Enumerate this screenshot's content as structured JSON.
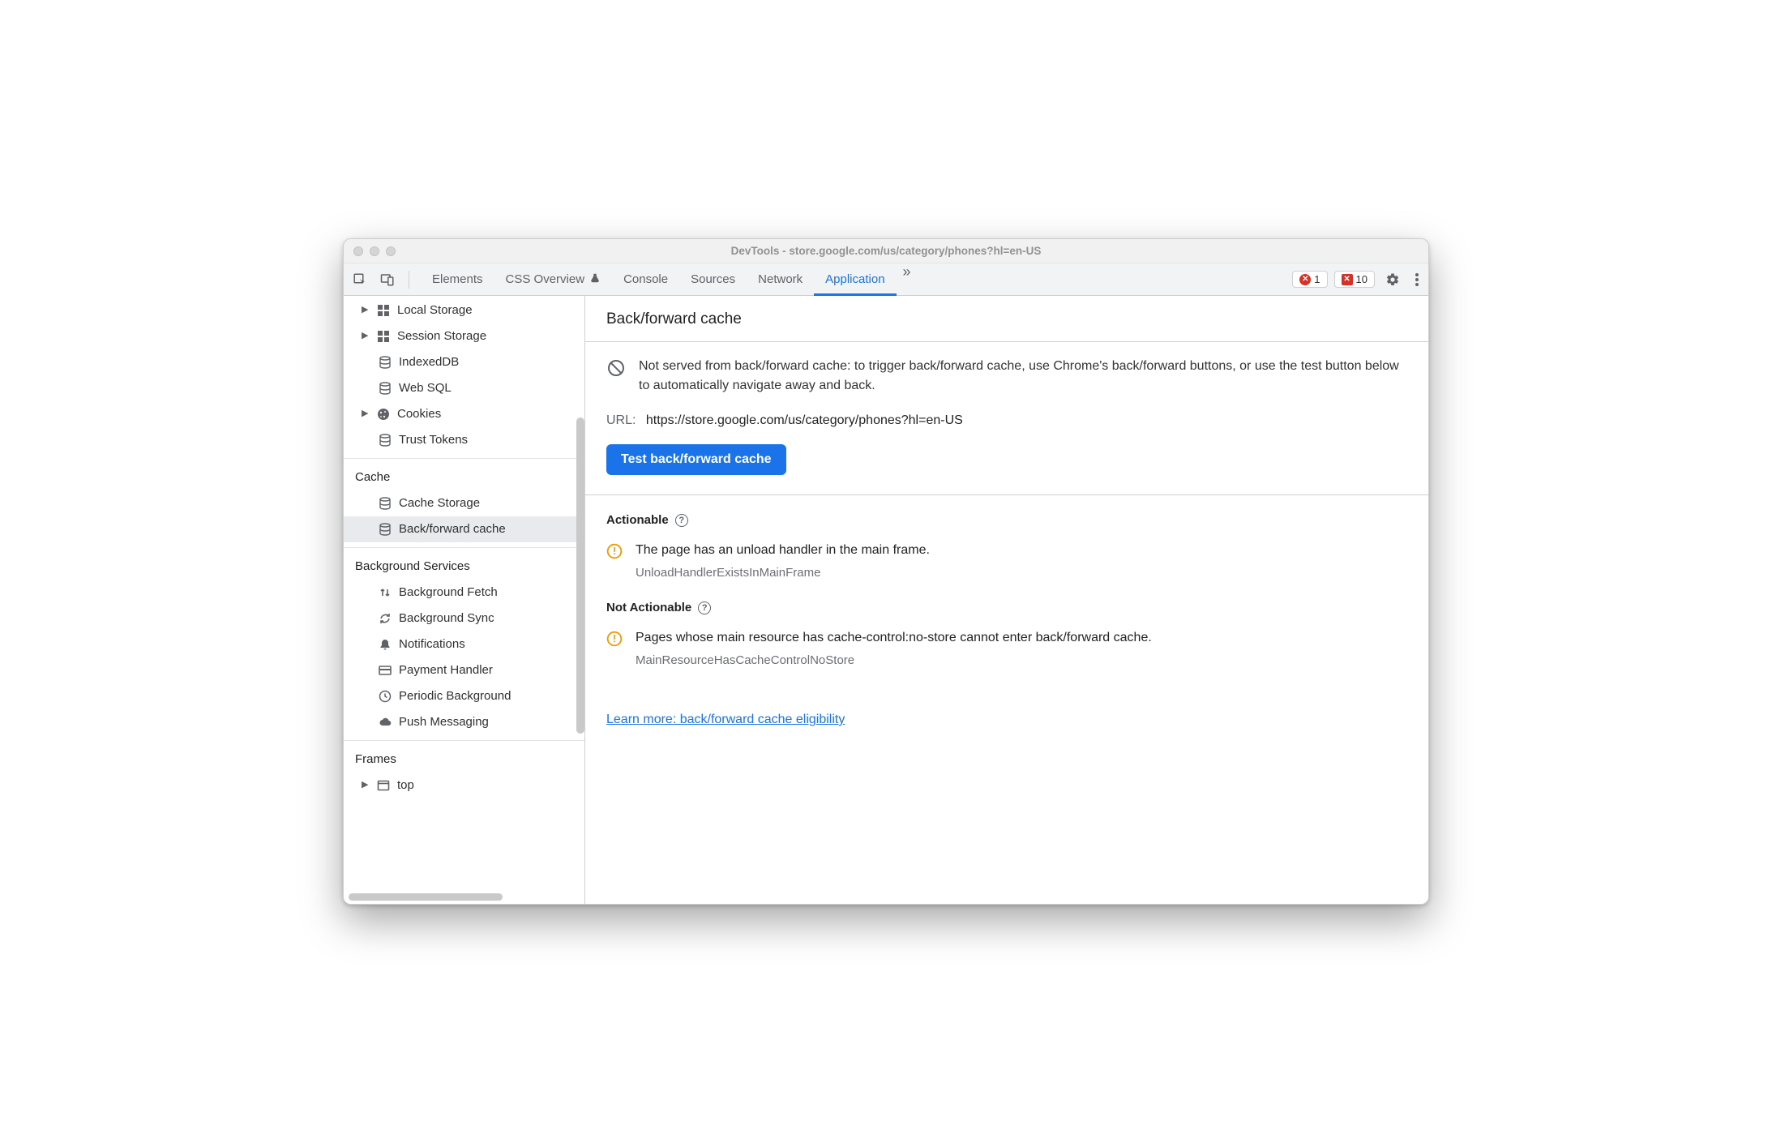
{
  "window": {
    "title": "DevTools - store.google.com/us/category/phones?hl=en-US"
  },
  "tabs": {
    "elements": "Elements",
    "css_overview": "CSS Overview",
    "console": "Console",
    "sources": "Sources",
    "network": "Network",
    "application": "Application"
  },
  "counters": {
    "errors": "1",
    "issues": "10"
  },
  "sidebar": {
    "storage": {
      "local_storage": "Local Storage",
      "session_storage": "Session Storage",
      "indexeddb": "IndexedDB",
      "web_sql": "Web SQL",
      "cookies": "Cookies",
      "trust_tokens": "Trust Tokens"
    },
    "cache": {
      "title": "Cache",
      "cache_storage": "Cache Storage",
      "bf_cache": "Back/forward cache"
    },
    "bg": {
      "title": "Background Services",
      "bg_fetch": "Background Fetch",
      "bg_sync": "Background Sync",
      "notifications": "Notifications",
      "payment": "Payment Handler",
      "periodic": "Periodic Background",
      "push": "Push Messaging"
    },
    "frames": {
      "title": "Frames",
      "top": "top"
    }
  },
  "content": {
    "title": "Back/forward cache",
    "info": "Not served from back/forward cache: to trigger back/forward cache, use Chrome's back/forward buttons, or use the test button below to automatically navigate away and back.",
    "url_label": "URL:",
    "url_value": "https://store.google.com/us/category/phones?hl=en-US",
    "test_btn": "Test back/forward cache",
    "group_actionable": "Actionable",
    "group_not_actionable": "Not Actionable",
    "actionable": {
      "text": "The page has an unload handler in the main frame.",
      "code": "UnloadHandlerExistsInMainFrame"
    },
    "not_actionable": {
      "text": "Pages whose main resource has cache-control:no-store cannot enter back/forward cache.",
      "code": "MainResourceHasCacheControlNoStore"
    },
    "learn_more": "Learn more: back/forward cache eligibility"
  }
}
